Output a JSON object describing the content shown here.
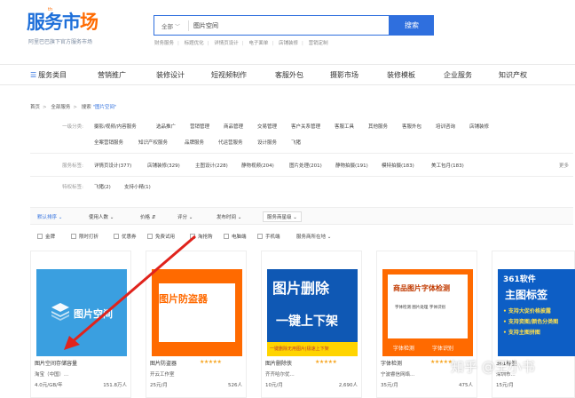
{
  "logo": {
    "text_main": "服务市",
    "text_accent": "场",
    "superscript": "th",
    "slogan": "阿里巴巴旗下官方服务市场"
  },
  "search": {
    "scope": "全部",
    "value": "图片空间",
    "button": "搜索"
  },
  "hot_words": [
    "财务服务",
    "标题优化",
    "详情页设计",
    "电子面单",
    "店铺装修",
    "营销定制"
  ],
  "nav": [
    "服务类目",
    "营销推广",
    "装修设计",
    "短视频制作",
    "客服外包",
    "摄影市场",
    "装修模板",
    "企业服务",
    "知识产权"
  ],
  "breadcrumb": {
    "home": "首页",
    "all": "全部服务",
    "search_label": "搜索",
    "query": "\"图片空间\""
  },
  "filters": {
    "level1_label": "一级分类:",
    "level1_row1": [
      "摄影/视频/内容服务",
      "选品推广",
      "营销管理",
      "商品管理",
      "交易管理",
      "客户关系管理",
      "客服工具",
      "其他服务",
      "客服外包",
      "培训咨询",
      "店铺装修"
    ],
    "level1_row2": [
      "全案营销服务",
      "知识产权服务",
      "品牌服务",
      "代运营服务",
      "设计服务",
      "飞猪"
    ],
    "tag_label": "服务标签:",
    "tags": [
      "详情页设计(377)",
      "店铺装修(329)",
      "主图设计(228)",
      "静物视频(204)",
      "图片处理(201)",
      "静物拍摄(191)",
      "模特拍摄(183)",
      "美工包月(183)"
    ],
    "more": "更多",
    "special_label": "特权标签:",
    "special": [
      "飞猪(2)",
      "支持小精(1)"
    ]
  },
  "sort": {
    "default": "默认排序",
    "users": "使用人数",
    "price": "价格",
    "rating": "评分",
    "publish": "发布时间",
    "sales": "服务商星级"
  },
  "checkboxes": [
    "金牌",
    "限时打折",
    "优惠券",
    "免费试用",
    "淘抢购",
    "电脑端",
    "手机端",
    "服务商所在地"
  ],
  "products": [
    {
      "thumb_text": "图片空间",
      "title": "图片空间存储容量",
      "rating": "",
      "shop": "淘宝（中国）...",
      "uses": "",
      "price": "4.0元/GB/年",
      "count": "151.8万人"
    },
    {
      "thumb_text": "图片防盗器",
      "title": "图片防盗器",
      "rating": "★★★★★",
      "shop": "开云工作室",
      "uses": "",
      "price": "25元/月",
      "count": "526人"
    },
    {
      "thumb_line1": "图片删除",
      "thumb_line2": "一键上下架",
      "thumb_bar": "一键删除无用图片|极速上下架",
      "title": "图片删除侠",
      "rating": "★★★★★",
      "shop": "齐齐哈尔优...",
      "uses": "",
      "price": "10元/月",
      "count": "2,690人"
    },
    {
      "thumb_title": "商品图片字体检测",
      "thumb_sub": "字体检测  图片处理  字体识别",
      "thumb_tag1": "字体检测",
      "thumb_tag2": "字体识别",
      "title": "字体检测",
      "rating": "★★★★★",
      "shop": "宁波睿信网络...",
      "uses": "",
      "price": "35元/月",
      "count": "475人"
    },
    {
      "thumb_brand": "361软件",
      "thumb_title": "主图标签",
      "thumb_b1": "• 支持大促价格披露",
      "thumb_b2": "• 支持资图/颜色分类图",
      "thumb_b3": "• 支持主图拼图",
      "title": "361标签",
      "rating": "",
      "shop": "深圳市...",
      "uses": "",
      "price": "15元/月",
      "count": ""
    }
  ],
  "watermark": "知乎 @王小书",
  "colors": {
    "brand_blue": "#2f6fde",
    "accent_orange": "#ff6a00",
    "arrow_red": "#e0231c"
  }
}
